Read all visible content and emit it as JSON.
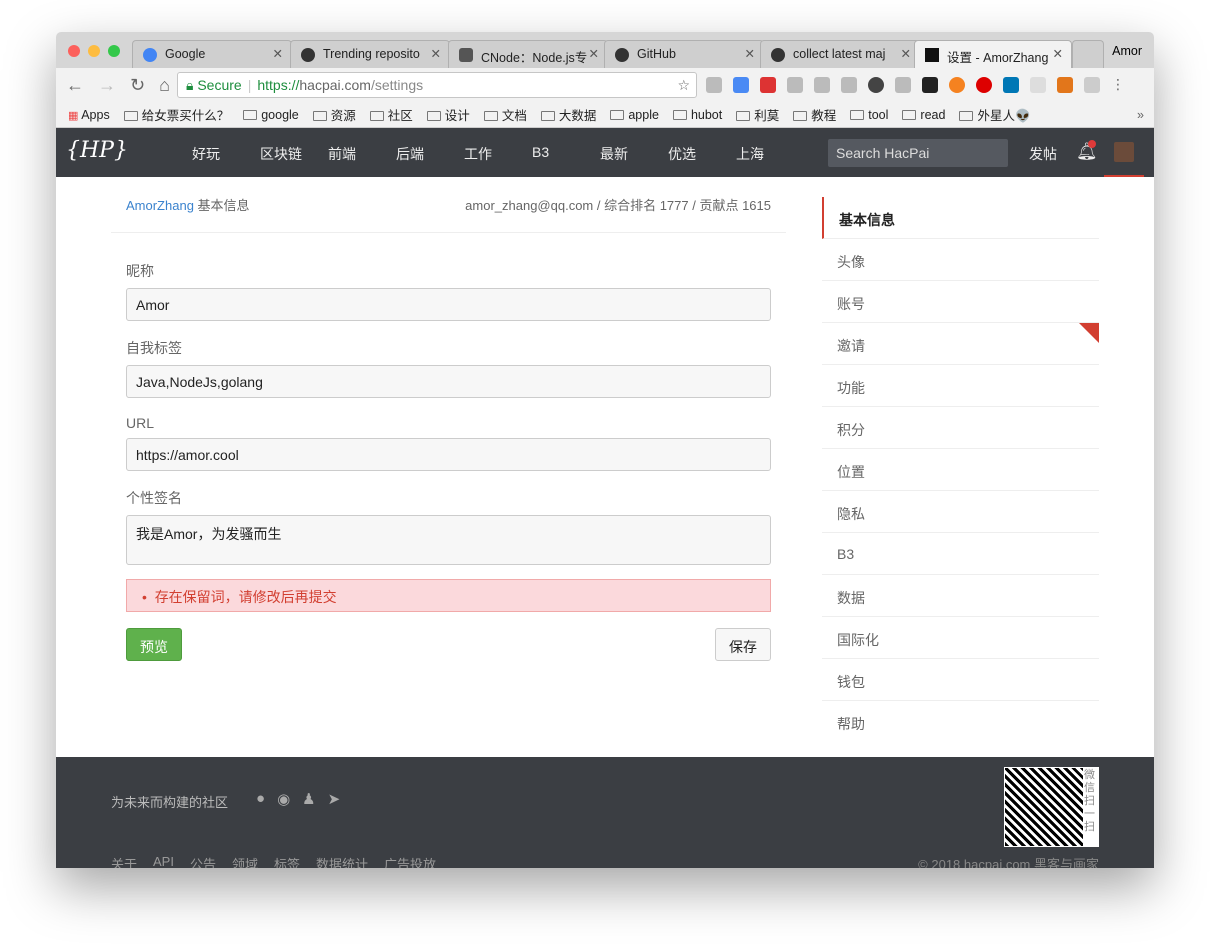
{
  "browser": {
    "tabs": [
      {
        "label": "Google",
        "icon": "google-icon"
      },
      {
        "label": "Trending reposito",
        "icon": "github-icon"
      },
      {
        "label": "CNode：Node.js专",
        "icon": "cnode-icon"
      },
      {
        "label": "GitHub",
        "icon": "github-icon"
      },
      {
        "label": "collect latest maj",
        "icon": "github-icon"
      },
      {
        "label": "设置 - AmorZhang",
        "icon": "hacpai-icon"
      }
    ],
    "profile": "Amor",
    "secure": "Secure",
    "url_scheme": "https://",
    "url_host": "hacpai.com",
    "url_path": "/settings",
    "bookmarks": [
      "Apps",
      "给女票买什么？",
      "google",
      "资源",
      "社区",
      "设计",
      "文档",
      "大数据",
      "apple",
      "hubot",
      "利莫",
      "教程",
      "tool",
      "read",
      "外星人👽"
    ],
    "more": "»"
  },
  "nav": {
    "logo": "{HP}",
    "items": [
      "好玩",
      "区块链",
      "前端",
      "后端",
      "工作",
      "B3",
      "最新",
      "优选",
      "上海"
    ],
    "search_placeholder": "Search HacPai",
    "post": "发帖"
  },
  "header": {
    "user": "AmorZhang",
    "section": "基本信息",
    "info": "amor_zhang@qq.com / 综合排名 1777 / 贡献点 1615"
  },
  "form": {
    "nick_label": "昵称",
    "nick": "Amor",
    "tags_label": "自我标签",
    "tags": "Java,NodeJs,golang",
    "url_label": "URL",
    "url": "https://amor.cool",
    "sign_label": "个性签名",
    "sign": "我是Amor，为发骚而生",
    "error": "存在保留词，请修改后再提交",
    "preview": "预览",
    "save": "保存"
  },
  "sidebar": [
    "基本信息",
    "头像",
    "账号",
    "邀请",
    "功能",
    "积分",
    "位置",
    "隐私",
    "B3",
    "数据",
    "国际化",
    "钱包",
    "帮助"
  ],
  "footer": {
    "slogan": "为未来而构建的社区",
    "links": [
      "关于",
      "API",
      "公告",
      "领域",
      "标签",
      "数据统计",
      "广告投放"
    ],
    "copyright": "© 2018 hacpai.com 黑客与画家",
    "qr_text": "微信扫一扫"
  },
  "colors": {
    "accent": "#d23f31",
    "nav_bg": "#3b3e43",
    "link": "#3b83ce",
    "button_green": "#5fb14c"
  }
}
